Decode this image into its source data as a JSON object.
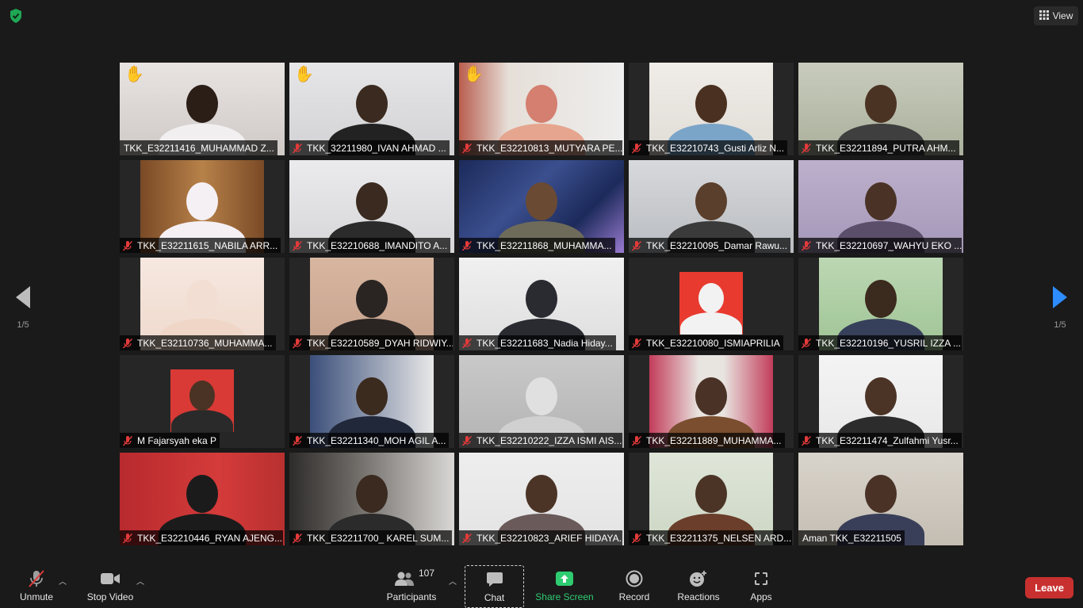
{
  "header": {
    "view_label": "View"
  },
  "colors": {
    "accent_green": "#2ecc71",
    "leave_red": "#c8302f",
    "active_border": "#c7e46b",
    "mute_red": "#e23a3a"
  },
  "navigation": {
    "prev_page": "1/5",
    "next_page": "1/5"
  },
  "participants": [
    {
      "name": "TKK_E32211416_MUHAMMAD Z...",
      "muted": false,
      "raised_hand": true
    },
    {
      "name": "TKK_32211980_IVAN AHMAD ...",
      "muted": true,
      "raised_hand": true
    },
    {
      "name": "TKK_E32210813_MUTYARA PE...",
      "muted": true,
      "raised_hand": true
    },
    {
      "name": "TKK_E32210743_Gusti Arliz N...",
      "muted": true,
      "raised_hand": false
    },
    {
      "name": "TKK_E32211894_PUTRA AHM...",
      "muted": true,
      "raised_hand": false
    },
    {
      "name": "TKK_E32211615_NABILA ARR...",
      "muted": true,
      "raised_hand": false
    },
    {
      "name": "TKK_E32210688_IMANDITO A...",
      "muted": true,
      "raised_hand": false
    },
    {
      "name": "TKK_E32211868_MUHAMMA...",
      "muted": true,
      "raised_hand": false
    },
    {
      "name": "TKK_E32210095_Damar Rawu...",
      "muted": true,
      "raised_hand": false
    },
    {
      "name": "TKK_E32210697_WAHYU EKO ...",
      "muted": true,
      "raised_hand": false
    },
    {
      "name": "TKK_E32110736_MUHAMMA...",
      "muted": true,
      "raised_hand": false
    },
    {
      "name": "TKK_E32210589_DYAH RIDWIY...",
      "muted": true,
      "raised_hand": false
    },
    {
      "name": "TKK_E32211683_Nadia Hiday...",
      "muted": true,
      "raised_hand": false
    },
    {
      "name": "TKK_E32210080_ISMIAPRILIA",
      "muted": true,
      "raised_hand": false
    },
    {
      "name": "TKK_E32210196_YUSRIL IZZA ...",
      "muted": true,
      "raised_hand": false
    },
    {
      "name": "M Fajarsyah eka P",
      "muted": true,
      "raised_hand": false
    },
    {
      "name": "TKK_E32211340_MOH AGIL A...",
      "muted": true,
      "raised_hand": false
    },
    {
      "name": "TKK_E32210222_IZZA ISMI AIS...",
      "muted": true,
      "raised_hand": false
    },
    {
      "name": "TKK_E32211889_MUHAMMA...",
      "muted": true,
      "raised_hand": false
    },
    {
      "name": "TKK_E32211474_Zulfahmi Yusr...",
      "muted": true,
      "raised_hand": false
    },
    {
      "name": "TKK_E32210446_RYAN AJENG...",
      "muted": true,
      "raised_hand": false
    },
    {
      "name": "TKK_E32211700_ KAREL SUM...",
      "muted": true,
      "raised_hand": false
    },
    {
      "name": "TKK_E32210823_ARIEF HIDAYA...",
      "muted": true,
      "raised_hand": false
    },
    {
      "name": "TKK_E32211375_NELSEN ARD...",
      "muted": true,
      "raised_hand": false
    },
    {
      "name": "Aman TKK_E32211505",
      "muted": false,
      "raised_hand": false,
      "active_speaker": true
    }
  ],
  "toolbar": {
    "unmute_label": "Unmute",
    "stop_video_label": "Stop Video",
    "participants_label": "Participants",
    "participants_count": "107",
    "chat_label": "Chat",
    "share_screen_label": "Share Screen",
    "record_label": "Record",
    "reactions_label": "Reactions",
    "apps_label": "Apps",
    "leave_label": "Leave"
  }
}
